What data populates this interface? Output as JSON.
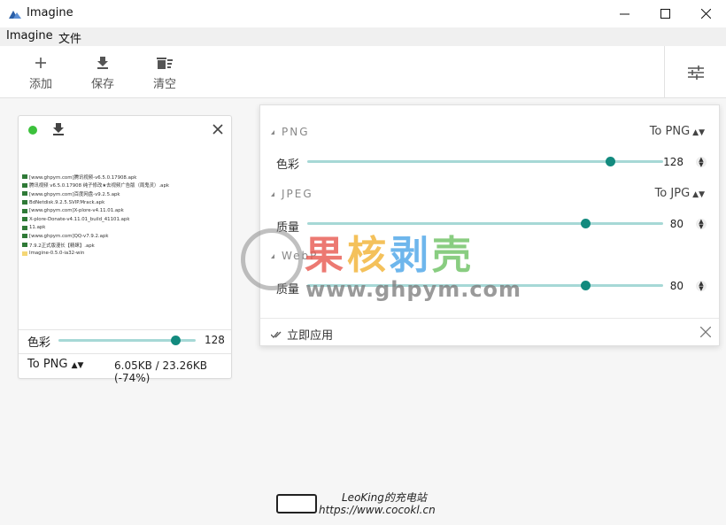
{
  "window": {
    "title": "Imagine",
    "min_label": "—",
    "max_label": "☐",
    "close_label": "✕"
  },
  "menu": [
    "Imagine",
    "文件"
  ],
  "toolbar": {
    "add_label": "添加",
    "save_label": "保存",
    "clear_label": "清空"
  },
  "image_card": {
    "status_color": "#3cc13c",
    "files": [
      "[www.ghpym.com]腾讯视频-v6.5.0.17908.apk",
      "腾讯视频 v6.5.0.17908 纯子修改★去视频广告版（周鬼灵）.apk",
      "[www.ghpym.com]百度网盘-v9.2.5.apk",
      "BdNetdisk.9.2.5.SVIP.Mrack.apk",
      "[www.ghpym.com]X-plore-v4.11.01.apk",
      "X-plore-Donate-v4.11.01_build_41101.apk",
      "11.apk",
      "[www.ghpym.com]QQ-v7.9.2.apk",
      "7.9.2正式版漫长【精睐】.apk",
      "Imagine-0.5.0-ia32-win"
    ],
    "color_label": "色彩",
    "color_value": "128",
    "color_fraction": 0.85,
    "format_label": "To PNG",
    "size_text": "6.05KB / 23.26KB (-74%)"
  },
  "settings_panel": {
    "png": {
      "header": "PNG",
      "format": "To PNG",
      "color_label": "色彩",
      "color_value": "128",
      "color_fraction": 0.85
    },
    "jpeg": {
      "header": "JPEG",
      "format": "To JPG",
      "quality_label": "质量",
      "quality_value": "80",
      "quality_fraction": 0.78
    },
    "webp": {
      "header": "WebP",
      "quality_label": "质量",
      "quality_value": "80",
      "quality_fraction": 0.78
    },
    "apply_label": "立即应用"
  },
  "watermark": {
    "chars": [
      "果",
      "核",
      "剥",
      "壳"
    ],
    "url": "www.ghpym.com"
  },
  "credit": {
    "line1": "LeoKing的充电站",
    "line2": "https://www.cocokl.cn"
  },
  "colors": {
    "accent": "#128a7e",
    "track": "#a6d8d6"
  }
}
